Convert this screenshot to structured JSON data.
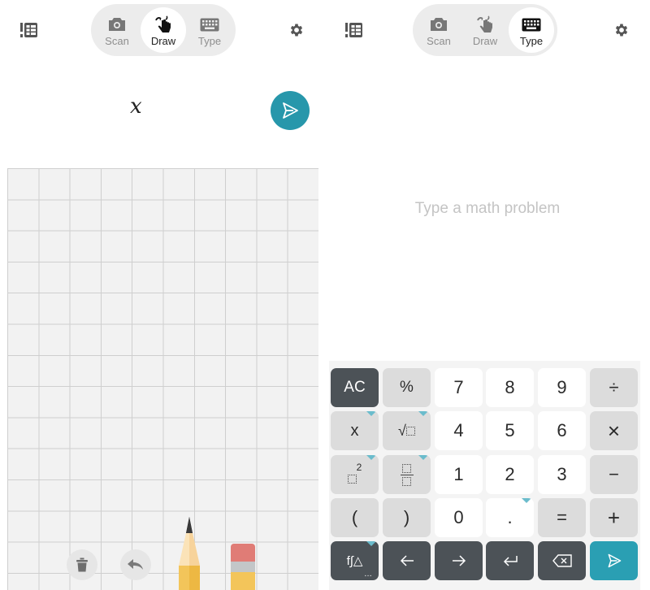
{
  "left_pane": {
    "mode_tabs": [
      {
        "label": "Scan",
        "icon": "camera-icon",
        "active": false
      },
      {
        "label": "Draw",
        "icon": "hand-draw-icon",
        "active": true
      },
      {
        "label": "Type",
        "icon": "keyboard-icon",
        "active": false
      }
    ],
    "history_icon": "history-list-icon",
    "settings_icon": "gear-icon",
    "recognized_expression": "x",
    "send_icon": "send-icon",
    "tools": {
      "trash_icon": "trash-icon",
      "undo_icon": "undo-icon",
      "pencil_icon": "pencil-icon",
      "eraser_icon": "eraser-icon"
    }
  },
  "right_pane": {
    "mode_tabs": [
      {
        "label": "Scan",
        "icon": "camera-icon",
        "active": false
      },
      {
        "label": "Draw",
        "icon": "hand-draw-icon",
        "active": false
      },
      {
        "label": "Type",
        "icon": "keyboard-icon",
        "active": true
      }
    ],
    "history_icon": "history-list-icon",
    "settings_icon": "gear-icon",
    "input_placeholder": "Type a math problem",
    "keypad": {
      "rows": [
        [
          "AC",
          "%",
          "7",
          "8",
          "9",
          "÷"
        ],
        [
          "x",
          "√□",
          "4",
          "5",
          "6",
          "×"
        ],
        [
          "□²",
          "□/□",
          "1",
          "2",
          "3",
          "−"
        ],
        [
          "(",
          ")",
          "0",
          ".",
          "=",
          "+"
        ],
        [
          "f∫△",
          "←",
          "→",
          "↵",
          "⌫",
          "send"
        ]
      ],
      "labels": {
        "ac": "AC",
        "percent": "%",
        "seven": "7",
        "eight": "8",
        "nine": "9",
        "divide": "÷",
        "x": "x",
        "four": "4",
        "five": "5",
        "six": "6",
        "multiply": "×",
        "one": "1",
        "two": "2",
        "three": "3",
        "minus": "−",
        "open_paren": "(",
        "close_paren": ")",
        "zero": "0",
        "dot": ".",
        "equals": "=",
        "plus": "+",
        "functions": "f∫△",
        "left": "←",
        "right": "→",
        "enter": "↵",
        "square_exponent": "2",
        "ellipsis": "…"
      }
    }
  },
  "colors": {
    "accent": "#2797ab",
    "key_dark": "#4c5257",
    "key_gray": "#dcdcdc",
    "canvas": "#f2f2f2",
    "pencil_yellow": "#f3c55a",
    "eraser_pink": "#e07c76"
  }
}
